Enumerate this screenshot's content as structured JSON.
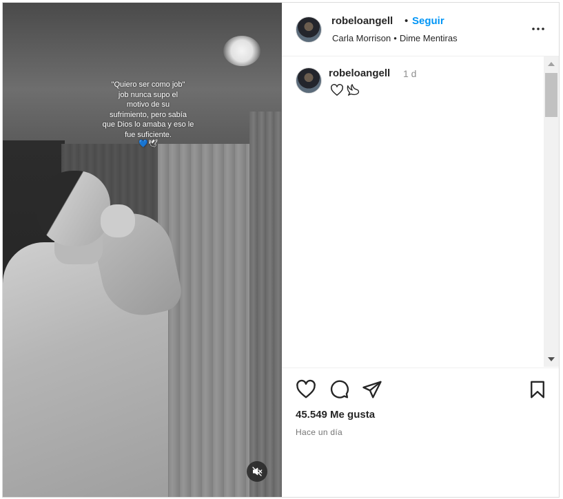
{
  "media": {
    "caption_lines": [
      "\"Quiero ser como job\"",
      "job nunca supo el",
      "motivo de su",
      "sufrimiento, pero sabía",
      "que Dios lo amaba y eso le",
      "fue suficiente."
    ],
    "caption_emoji": "💙🕊",
    "mute_icon": "speaker-muted-icon"
  },
  "post_header": {
    "username": "robeloangell",
    "separator": "•",
    "follow_label": "Seguir",
    "audio_artist": "Carla Morrison",
    "audio_separator": "•",
    "audio_track": "Dime Mentiras",
    "more_icon": "more-options-icon"
  },
  "comments": [
    {
      "username": "robeloangell",
      "time": "1 d",
      "text_icons": [
        "heart-outline-icon",
        "dove-icon"
      ]
    }
  ],
  "actions": {
    "icons": [
      "heart-icon",
      "comment-icon",
      "share-icon",
      "bookmark-icon"
    ],
    "likes_text": "45.549 Me gusta",
    "posted_ago": "Hace un día"
  },
  "colors": {
    "accent_follow": "#0095f6",
    "text_primary": "#262626",
    "text_secondary": "#8e8e8e"
  }
}
